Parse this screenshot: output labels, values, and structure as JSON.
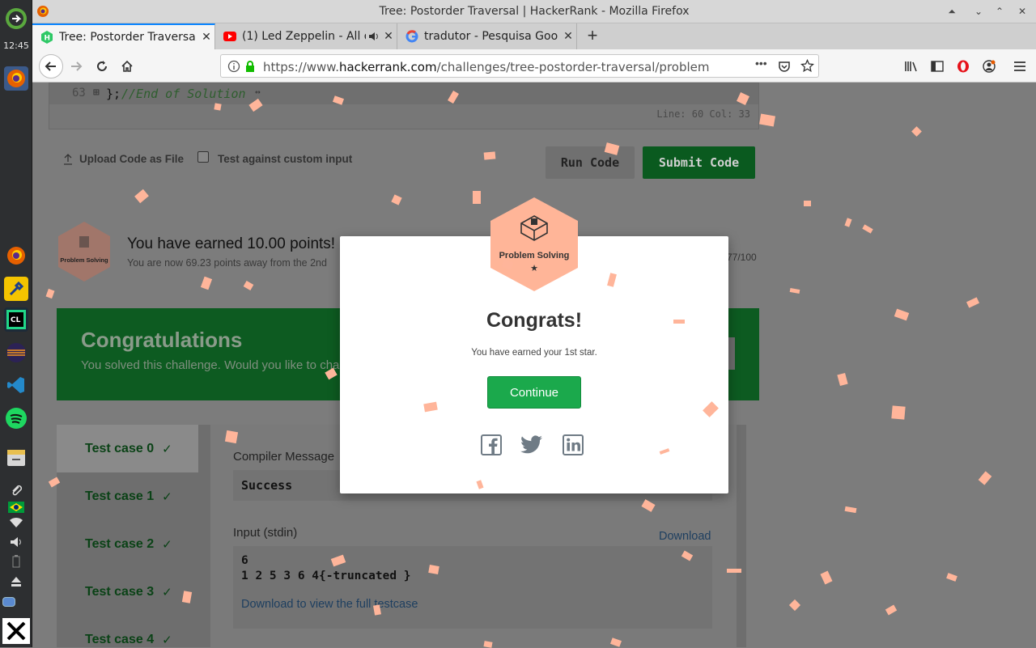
{
  "window": {
    "title": "Tree: Postorder Traversal | HackerRank - Mozilla Firefox"
  },
  "dock": {
    "clock": "12:45"
  },
  "tabs": [
    {
      "label": "Tree: Postorder Traversa",
      "active": true
    },
    {
      "label": "(1) Led Zeppelin - All o",
      "active": false
    },
    {
      "label": "tradutor - Pesquisa Goo",
      "active": false
    }
  ],
  "navbar": {
    "url_prefix": "https://www.",
    "url_domain": "hackerrank.com",
    "url_path": "/challenges/tree-postorder-traversal/problem",
    "overflow": "•••"
  },
  "editor": {
    "line_number": "63",
    "fold_marker": "⊞",
    "code_brace": "};",
    "code_comment": " //End of Solution",
    "ellipsis": "↔",
    "status": "Line: 60 Col: 33"
  },
  "actions": {
    "upload_label": "Upload Code as File",
    "custom_input_label": "Test against custom input",
    "run_label": "Run Code",
    "submit_label": "Submit Code"
  },
  "points": {
    "badge_label": "Problem Solving",
    "earned": "You have earned 10.00 points!",
    "away": "You are now 69.23 points away from the 2nd",
    "progress": "77/100"
  },
  "banner": {
    "title": "Congratulations",
    "text": "You solved this challenge. Would you like to cha"
  },
  "testcases": {
    "items": [
      "Test case 0",
      "Test case 1",
      "Test case 2",
      "Test case 3",
      "Test case 4"
    ],
    "compiler_label": "Compiler Message",
    "compiler_value": "Success",
    "input_label": "Input (stdin)",
    "download_label": "Download",
    "input_line1": "6",
    "input_line2": "1 2 5 3 6 4{-truncated }",
    "full_testcase_link": "Download to view the full testcase"
  },
  "modal": {
    "badge_label": "Problem Solving",
    "badge_star": "★",
    "heading": "Congrats!",
    "subtext": "You have earned your 1st star.",
    "continue_label": "Continue"
  },
  "colors": {
    "accent_green": "#1ba94c",
    "confetti": "#ffb59a",
    "badge": "#ffb598"
  }
}
